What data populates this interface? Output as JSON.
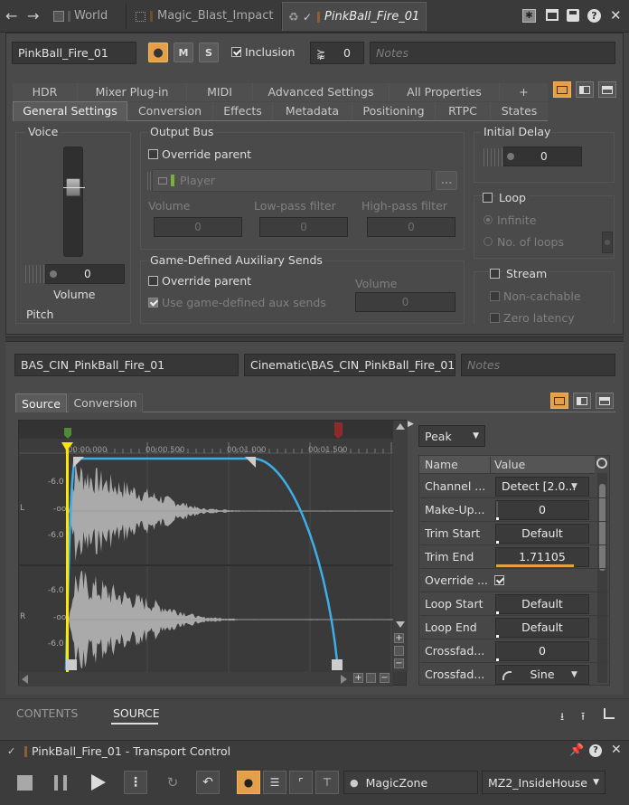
{
  "tabs": [
    {
      "label": "World"
    },
    {
      "label": "Magic_Blast_Impact"
    },
    {
      "label": "PinkBall_Fire_01"
    }
  ],
  "object": {
    "name": "PinkBall_Fire_01",
    "m_label": "M",
    "s_label": "S",
    "inclusion_label": "Inclusion",
    "share_count": "0",
    "notes_placeholder": "Notes"
  },
  "tab_rows": {
    "top": [
      "HDR",
      "Mixer Plug-in",
      "MIDI",
      "Advanced Settings",
      "All Properties",
      "+"
    ],
    "bottom": [
      "General Settings",
      "Conversion",
      "Effects",
      "Metadata",
      "Positioning",
      "RTPC",
      "States"
    ]
  },
  "voice": {
    "title": "Voice",
    "value": "0",
    "volume_label": "Volume",
    "pitch_label": "Pitch",
    "slider_level": 0.5
  },
  "output_bus": {
    "title": "Output Bus",
    "override_label": "Override parent",
    "bus_name": "Player",
    "browse_label": "...",
    "volume_label": "Volume",
    "lowpass_label": "Low-pass filter",
    "highpass_label": "High-pass filter",
    "volume_value": "0",
    "lowpass_value": "0",
    "highpass_value": "0"
  },
  "aux": {
    "title": "Game-Defined Auxiliary Sends",
    "override_label": "Override parent",
    "use_label": "Use game-defined aux sends",
    "volume_label": "Volume",
    "volume_value": "0"
  },
  "initial_delay": {
    "title": "Initial Delay",
    "value": "0"
  },
  "loop": {
    "label": "Loop",
    "infinite": "Infinite",
    "no_loops": "No. of loops"
  },
  "stream": {
    "label": "Stream",
    "noncachable": "Non-cachable",
    "zero_latency": "Zero latency"
  },
  "source": {
    "name": "BAS_CIN_PinkBall_Fire_01",
    "path": "Cinematic\\BAS_CIN_PinkBall_Fire_01....",
    "notes_placeholder": "Notes",
    "tabs": [
      "Source",
      "Conversion"
    ]
  },
  "waveform": {
    "time_labels": [
      "00:00.000",
      "00:00.500",
      "00:01.000",
      "00:01.500"
    ],
    "db_labels": [
      "-6.0",
      "-oo",
      "-6.0",
      "-6.0",
      "-oo",
      "-6.0"
    ],
    "channel_labels": [
      "L",
      "R"
    ]
  },
  "props": {
    "peak_label": "Peak",
    "col_name": "Name",
    "col_value": "Value",
    "rows": [
      {
        "name": "Channel ...",
        "value": "Detect [2.0..."
      },
      {
        "name": "Make-Up...",
        "value": "0"
      },
      {
        "name": "Trim Start",
        "value": "Default"
      },
      {
        "name": "Trim End",
        "value": "1.71105"
      },
      {
        "name": "Override ...",
        "value": ""
      },
      {
        "name": "Loop Start",
        "value": "Default"
      },
      {
        "name": "Loop End",
        "value": "Default"
      },
      {
        "name": "Crossfad...",
        "value": "0"
      },
      {
        "name": "Crossfad...",
        "value": "Sine"
      }
    ]
  },
  "bottom_tabs": {
    "contents": "CONTENTS",
    "source": "SOURCE"
  },
  "transport": {
    "title": "PinkBall_Fire_01 - Transport Control",
    "zone": "MagicZone",
    "state": "MZ2_InsideHouse"
  },
  "colors": {
    "accent": "#e39f4a",
    "envelope": "#3daee9",
    "marker": "#ffe600",
    "bus_tag": "#7aaf3a",
    "object_tag": "#8b5e34"
  }
}
